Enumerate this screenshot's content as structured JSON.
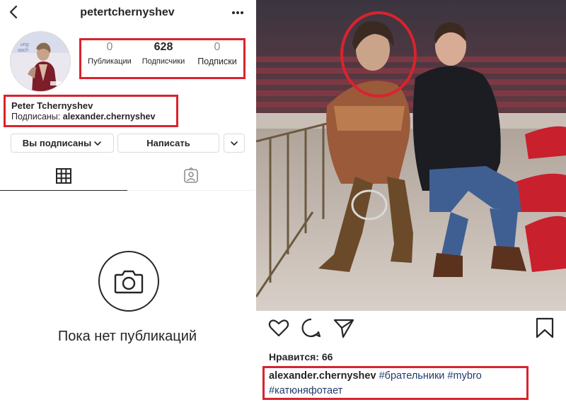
{
  "profile": {
    "username": "petertchernyshev",
    "full_name": "Peter Tchernyshev",
    "followed_by_label": "Подписаны:",
    "followed_by_user": "alexander.chernyshev",
    "stats": [
      {
        "value": "0",
        "label": "Публикации"
      },
      {
        "value": "628",
        "label": "Подписчики"
      },
      {
        "value": "0",
        "label": "Подписки"
      }
    ],
    "buttons": {
      "following": "Вы подписаны",
      "message": "Написать"
    },
    "empty_state": "Пока нет публикаций",
    "icons": [
      "back-icon",
      "more-icon",
      "chevron-down-icon",
      "grid-icon",
      "tagged-icon",
      "camera-icon"
    ]
  },
  "post": {
    "likes": "Нравится: 66",
    "author": "alexander.chernyshev",
    "hashtags": [
      "#брательники",
      "#mybro",
      "#катюняфотает"
    ],
    "icons": [
      "heart-icon",
      "comment-icon",
      "share-icon",
      "bookmark-icon"
    ]
  },
  "colors": {
    "highlight": "#d9232e",
    "text": "#262626",
    "secondary": "#8e8e8e",
    "hashtag": "#233b6e",
    "border": "#dbdbdb"
  }
}
